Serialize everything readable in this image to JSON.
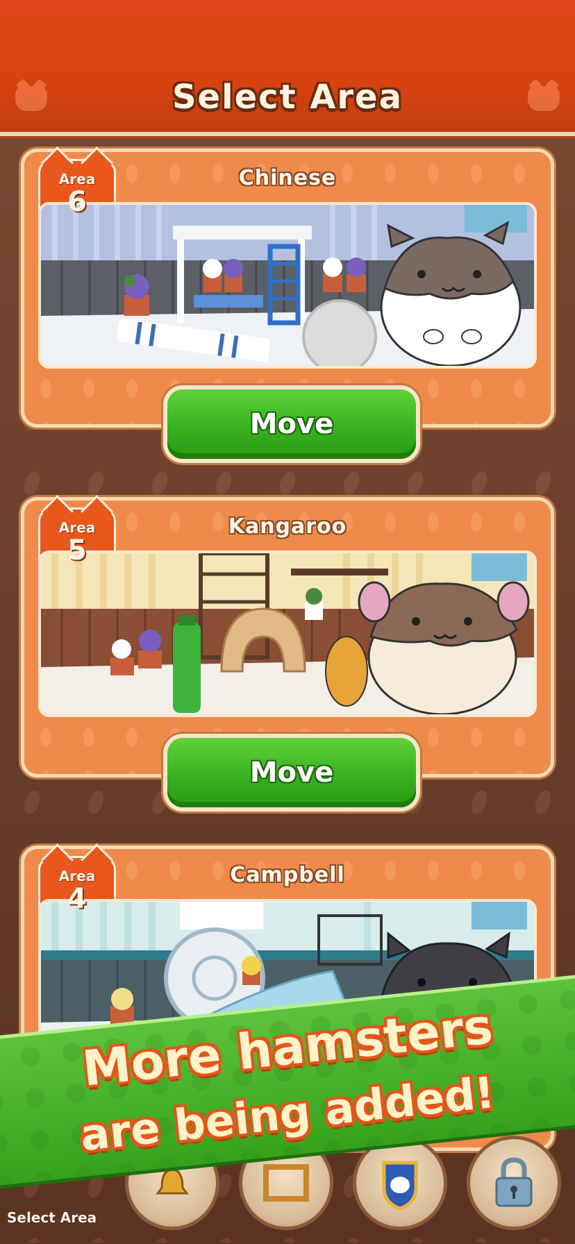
{
  "header": {
    "title": "Select Area"
  },
  "areas": [
    {
      "badge_label": "Area",
      "number": "6",
      "name": "Chinese",
      "button": "Move"
    },
    {
      "badge_label": "Area",
      "number": "5",
      "name": "Kangaroo",
      "button": "Move"
    },
    {
      "badge_label": "Area",
      "number": "4",
      "name": "Campbell"
    }
  ],
  "promo": {
    "line1": "More hamsters",
    "line2": "are being added!"
  },
  "bottom_nav": {
    "label": "Select Area",
    "icons": [
      "bell-icon",
      "frame-icon",
      "shield-icon",
      "lock-icon"
    ]
  },
  "colors": {
    "header": "#d8420f",
    "card": "#f08a4b",
    "button": "#38b21f",
    "promo": "#43ac24",
    "promo_text": "#fff3c9",
    "promo_outline": "#e0571b"
  }
}
